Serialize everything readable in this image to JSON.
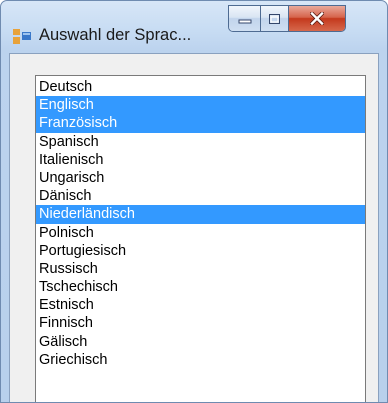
{
  "window": {
    "title": "Auswahl der Sprac...",
    "icon": "app-window-icon",
    "buttons": {
      "minimize": "minimize-icon",
      "maximize": "maximize-icon",
      "close": "close-icon"
    }
  },
  "colors": {
    "selection": "#3399ff",
    "close_button": "#c4391d"
  },
  "list": {
    "items": [
      {
        "label": "Deutsch",
        "selected": false
      },
      {
        "label": "Englisch",
        "selected": true
      },
      {
        "label": "Französisch",
        "selected": true
      },
      {
        "label": "Spanisch",
        "selected": false
      },
      {
        "label": "Italienisch",
        "selected": false
      },
      {
        "label": "Ungarisch",
        "selected": false
      },
      {
        "label": "Dänisch",
        "selected": false
      },
      {
        "label": "Niederländisch",
        "selected": true
      },
      {
        "label": "Polnisch",
        "selected": false
      },
      {
        "label": "Portugiesisch",
        "selected": false
      },
      {
        "label": "Russisch",
        "selected": false
      },
      {
        "label": "Tschechisch",
        "selected": false
      },
      {
        "label": "Estnisch",
        "selected": false
      },
      {
        "label": "Finnisch",
        "selected": false
      },
      {
        "label": "Gälisch",
        "selected": false
      },
      {
        "label": "Griechisch",
        "selected": false
      }
    ]
  }
}
